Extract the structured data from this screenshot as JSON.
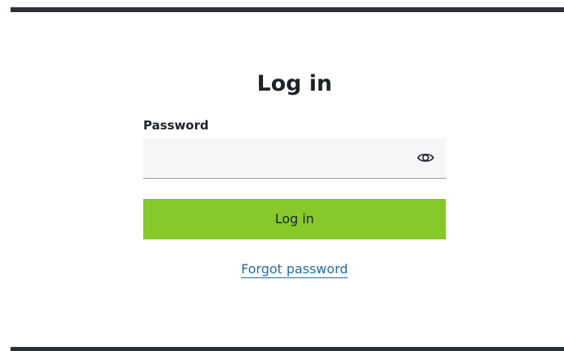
{
  "page": {
    "title": "Log in"
  },
  "form": {
    "password_label": "Password",
    "password_value": "",
    "password_placeholder": "",
    "show_password_icon": "eye-icon",
    "submit_label": "Log in",
    "forgot_password_label": "Forgot password"
  },
  "colors": {
    "accent": "#86c92a",
    "link": "#1f6ca0",
    "frame_bar": "#2e3238",
    "field_background": "#f6f5f7",
    "text": "#1e2328"
  }
}
